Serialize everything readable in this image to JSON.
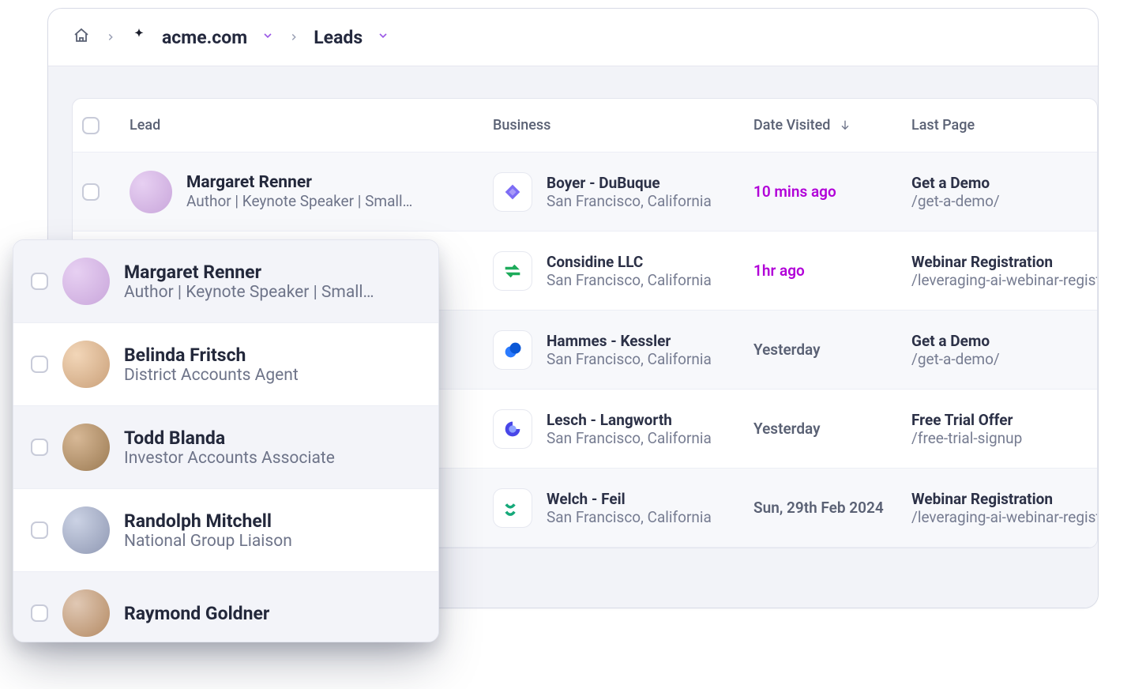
{
  "breadcrumb": {
    "home_icon": "home-icon",
    "brand_icon": "sparkle-icon",
    "site_label": "acme.com",
    "section_label": "Leads"
  },
  "columns": {
    "lead": "Lead",
    "business": "Business",
    "date": "Date Visited",
    "lastpage": "Last Page"
  },
  "rows": [
    {
      "lead_name": "Margaret Renner",
      "lead_sub": "Author | Keynote Speaker | Small…",
      "biz_name": "Boyer - DuBuque",
      "biz_loc": "San Francisco, California",
      "date": "10 mins ago",
      "date_hot": true,
      "lp_title": "Get a Demo",
      "lp_path": "/get-a-demo/",
      "logo": "logo-violet",
      "avatar": "av-a"
    },
    {
      "lead_name": "",
      "lead_sub": "",
      "biz_name": "Considine LLC",
      "biz_loc": "San Francisco, California",
      "date": "1hr ago",
      "date_hot": true,
      "lp_title": "Webinar Registration",
      "lp_path": "/leveraging-ai-webinar-register",
      "logo": "logo-green",
      "avatar": ""
    },
    {
      "lead_name": "",
      "lead_sub": "",
      "biz_name": "Hammes - Kessler",
      "biz_loc": "San Francisco, California",
      "date": "Yesterday",
      "date_hot": false,
      "lp_title": "Get a Demo",
      "lp_path": "/get-a-demo/",
      "logo": "logo-blue",
      "avatar": ""
    },
    {
      "lead_name": "",
      "lead_sub": "",
      "biz_name": "Lesch - Langworth",
      "biz_loc": "San Francisco, California",
      "date": "Yesterday",
      "date_hot": false,
      "lp_title": "Free Trial Offer",
      "lp_path": "/free-trial-signup",
      "logo": "logo-indigo",
      "avatar": ""
    },
    {
      "lead_name": "",
      "lead_sub": "",
      "biz_name": "Welch - Feil",
      "biz_loc": "San Francisco, California",
      "date": "Sun, 29th Feb 2024",
      "date_hot": false,
      "lp_title": "Webinar Registration",
      "lp_path": "/leveraging-ai-webinar-register",
      "logo": "logo-teal",
      "avatar": ""
    }
  ],
  "popover": [
    {
      "name": "Margaret Renner",
      "sub": "Author | Keynote Speaker | Small…",
      "avatar": "av-a",
      "selected": true
    },
    {
      "name": "Belinda Fritsch",
      "sub": "District Accounts Agent",
      "avatar": "av-b",
      "selected": false
    },
    {
      "name": "Todd Blanda",
      "sub": "Investor Accounts Associate",
      "avatar": "av-c",
      "selected": false
    },
    {
      "name": "Randolph Mitchell",
      "sub": "National Group Liaison",
      "avatar": "av-d",
      "selected": false
    },
    {
      "name": "Raymond Goldner",
      "sub": "",
      "avatar": "av-e",
      "selected": false
    }
  ]
}
